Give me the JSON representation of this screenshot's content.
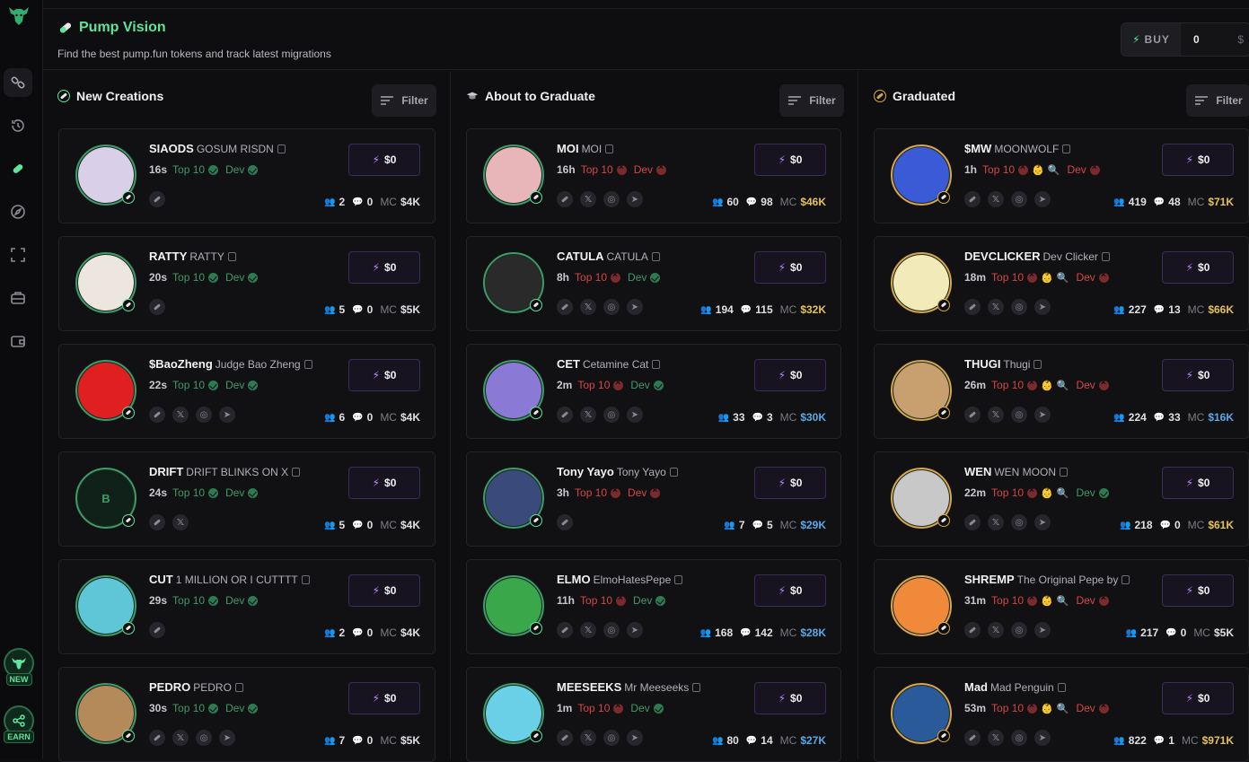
{
  "app": {
    "title": "Pump Vision",
    "subtitle": "Find the best pump.fun tokens and track latest migrations"
  },
  "buy_widget": {
    "label": "BUY",
    "amount": "0",
    "currency": "$"
  },
  "sidebar": {
    "promos": [
      {
        "tag": "NEW"
      },
      {
        "tag": "EARN"
      }
    ]
  },
  "columns": [
    {
      "title": "New Creations",
      "filter_label": "Filter",
      "items": [
        {
          "symbol": "SIAODS",
          "name": "GOSUM RISDN",
          "age": "16s",
          "top10": "Top 10",
          "top10_ok": true,
          "dev": "Dev",
          "dev_ok": true,
          "holders": "2",
          "replies": "0",
          "mc": "$4K",
          "mc_color": "w",
          "buy": "$0",
          "avatar_color": "#d9cfe8",
          "links": [
            "pump"
          ]
        },
        {
          "symbol": "RATTY",
          "name": "RATTY",
          "age": "20s",
          "top10": "Top 10",
          "top10_ok": true,
          "dev": "Dev",
          "dev_ok": true,
          "holders": "5",
          "replies": "0",
          "mc": "$5K",
          "mc_color": "w",
          "buy": "$0",
          "avatar_color": "#ece6de",
          "links": [
            "pump"
          ]
        },
        {
          "symbol": "$BaoZheng",
          "name": "Judge Bao Zheng",
          "age": "22s",
          "top10": "Top 10",
          "top10_ok": true,
          "dev": "Dev",
          "dev_ok": true,
          "holders": "6",
          "replies": "0",
          "mc": "$4K",
          "mc_color": "w",
          "buy": "$0",
          "avatar_color": "#e02020",
          "links": [
            "pump",
            "x",
            "web",
            "tg"
          ]
        },
        {
          "symbol": "DRIFT",
          "name": "DRIFT BLINKS ON X",
          "age": "24s",
          "top10": "Top 10",
          "top10_ok": true,
          "dev": "Dev",
          "dev_ok": true,
          "holders": "5",
          "replies": "0",
          "mc": "$4K",
          "mc_color": "w",
          "buy": "$0",
          "avatar_color": "#0f2119",
          "avatar_letter": "B",
          "links": [
            "pump",
            "x"
          ]
        },
        {
          "symbol": "CUT",
          "name": "1 MILLION OR I CUTTTT",
          "age": "29s",
          "top10": "Top 10",
          "top10_ok": true,
          "dev": "Dev",
          "dev_ok": true,
          "holders": "2",
          "replies": "0",
          "mc": "$4K",
          "mc_color": "w",
          "buy": "$0",
          "avatar_color": "#5ec6d6",
          "links": [
            "pump"
          ]
        },
        {
          "symbol": "PEDRO",
          "name": "PEDRO",
          "age": "30s",
          "top10": "Top 10",
          "top10_ok": true,
          "dev": "Dev",
          "dev_ok": true,
          "holders": "7",
          "replies": "0",
          "mc": "$5K",
          "mc_color": "w",
          "buy": "$0",
          "avatar_color": "#b58a5a",
          "links": [
            "pump",
            "x",
            "web",
            "tg"
          ]
        }
      ]
    },
    {
      "title": "About to Graduate",
      "filter_label": "Filter",
      "items": [
        {
          "symbol": "MOI",
          "name": "MOI",
          "age": "16h",
          "top10": "Top 10",
          "top10_ok": false,
          "dev": "Dev",
          "dev_ok": false,
          "holders": "60",
          "replies": "98",
          "mc": "$46K",
          "mc_color": "y",
          "buy": "$0",
          "avatar_color": "#e8b6b8",
          "links": [
            "pump",
            "x",
            "web",
            "tg"
          ]
        },
        {
          "symbol": "CATULA",
          "name": "CATULA",
          "age": "8h",
          "top10": "Top 10",
          "top10_ok": false,
          "dev": "Dev",
          "dev_ok": true,
          "holders": "194",
          "replies": "115",
          "mc": "$32K",
          "mc_color": "y",
          "buy": "$0",
          "avatar_color": "#2a2a2a",
          "links": [
            "pump",
            "x",
            "web",
            "tg"
          ]
        },
        {
          "symbol": "CET",
          "name": "Cetamine Cat",
          "age": "2m",
          "top10": "Top 10",
          "top10_ok": false,
          "dev": "Dev",
          "dev_ok": true,
          "holders": "33",
          "replies": "3",
          "mc": "$30K",
          "mc_color": "b",
          "buy": "$0",
          "avatar_color": "#8a7ad6",
          "links": [
            "pump",
            "x",
            "web",
            "tg"
          ]
        },
        {
          "symbol": "Tony Yayo",
          "name": "Tony Yayo",
          "age": "3h",
          "top10": "Top 10",
          "top10_ok": false,
          "dev": "Dev",
          "dev_ok": false,
          "holders": "7",
          "replies": "5",
          "mc": "$29K",
          "mc_color": "b",
          "buy": "$0",
          "avatar_color": "#3a4a7a",
          "links": [
            "pump"
          ]
        },
        {
          "symbol": "ELMO",
          "name": "ElmoHatesPepe",
          "age": "11h",
          "top10": "Top 10",
          "top10_ok": false,
          "dev": "Dev",
          "dev_ok": true,
          "holders": "168",
          "replies": "142",
          "mc": "$28K",
          "mc_color": "b",
          "buy": "$0",
          "avatar_color": "#3aa84a",
          "links": [
            "pump",
            "x",
            "web",
            "tg"
          ]
        },
        {
          "symbol": "MEESEEKS",
          "name": "Mr Meeseeks",
          "age": "1m",
          "top10": "Top 10",
          "top10_ok": false,
          "dev": "Dev",
          "dev_ok": true,
          "holders": "80",
          "replies": "14",
          "mc": "$27K",
          "mc_color": "b",
          "buy": "$0",
          "avatar_color": "#6ad0e8",
          "links": [
            "pump",
            "x",
            "web",
            "tg"
          ]
        }
      ]
    },
    {
      "title": "Graduated",
      "filter_label": "Filter",
      "items": [
        {
          "symbol": "$MW",
          "name": "MOONWOLF",
          "age": "1h",
          "top10": "Top 10",
          "top10_ok": false,
          "dev": "Dev",
          "dev_ok": false,
          "holders": "419",
          "replies": "48",
          "mc": "$71K",
          "mc_color": "y",
          "buy": "$0",
          "avatar_color": "#3a5ad6",
          "links": [
            "pump",
            "x",
            "web",
            "tg"
          ]
        },
        {
          "symbol": "DEVCLICKER",
          "name": "Dev Clicker",
          "age": "18m",
          "top10": "Top 10",
          "top10_ok": false,
          "dev": "Dev",
          "dev_ok": false,
          "holders": "227",
          "replies": "13",
          "mc": "$66K",
          "mc_color": "y",
          "buy": "$0",
          "avatar_color": "#f2eab8",
          "links": [
            "pump",
            "x",
            "web",
            "tg"
          ]
        },
        {
          "symbol": "THUGI",
          "name": "Thugi",
          "age": "26m",
          "top10": "Top 10",
          "top10_ok": false,
          "dev": "Dev",
          "dev_ok": false,
          "holders": "224",
          "replies": "33",
          "mc": "$16K",
          "mc_color": "b",
          "buy": "$0",
          "avatar_color": "#c8a070",
          "links": [
            "pump",
            "x",
            "web",
            "tg"
          ]
        },
        {
          "symbol": "WEN",
          "name": "WEN MOON",
          "age": "22m",
          "top10": "Top 10",
          "top10_ok": false,
          "dev": "Dev",
          "dev_ok": true,
          "holders": "218",
          "replies": "0",
          "mc": "$61K",
          "mc_color": "y",
          "buy": "$0",
          "avatar_color": "#c8c8c8",
          "links": [
            "pump",
            "x",
            "web",
            "tg"
          ]
        },
        {
          "symbol": "SHREMP",
          "name": "The Original Pepe by",
          "age": "31m",
          "top10": "Top 10",
          "top10_ok": false,
          "dev": "Dev",
          "dev_ok": false,
          "holders": "217",
          "replies": "0",
          "mc": "$5K",
          "mc_color": "w",
          "buy": "$0",
          "avatar_color": "#f08a3a",
          "links": [
            "pump",
            "x",
            "web",
            "tg"
          ]
        },
        {
          "symbol": "Mad",
          "name": "Mad Penguin",
          "age": "53m",
          "top10": "Top 10",
          "top10_ok": false,
          "dev": "Dev",
          "dev_ok": false,
          "holders": "822",
          "replies": "1",
          "mc": "$971K",
          "mc_color": "y",
          "buy": "$0",
          "avatar_color": "#2a5a9a",
          "links": [
            "pump",
            "x",
            "web",
            "tg"
          ]
        }
      ]
    }
  ],
  "labels": {
    "mc": "MC"
  },
  "colors": {
    "accent": "#5ee59b",
    "gold": "#d8a64a",
    "bad": "#d64545",
    "buy_bolt": "#b586ff"
  }
}
